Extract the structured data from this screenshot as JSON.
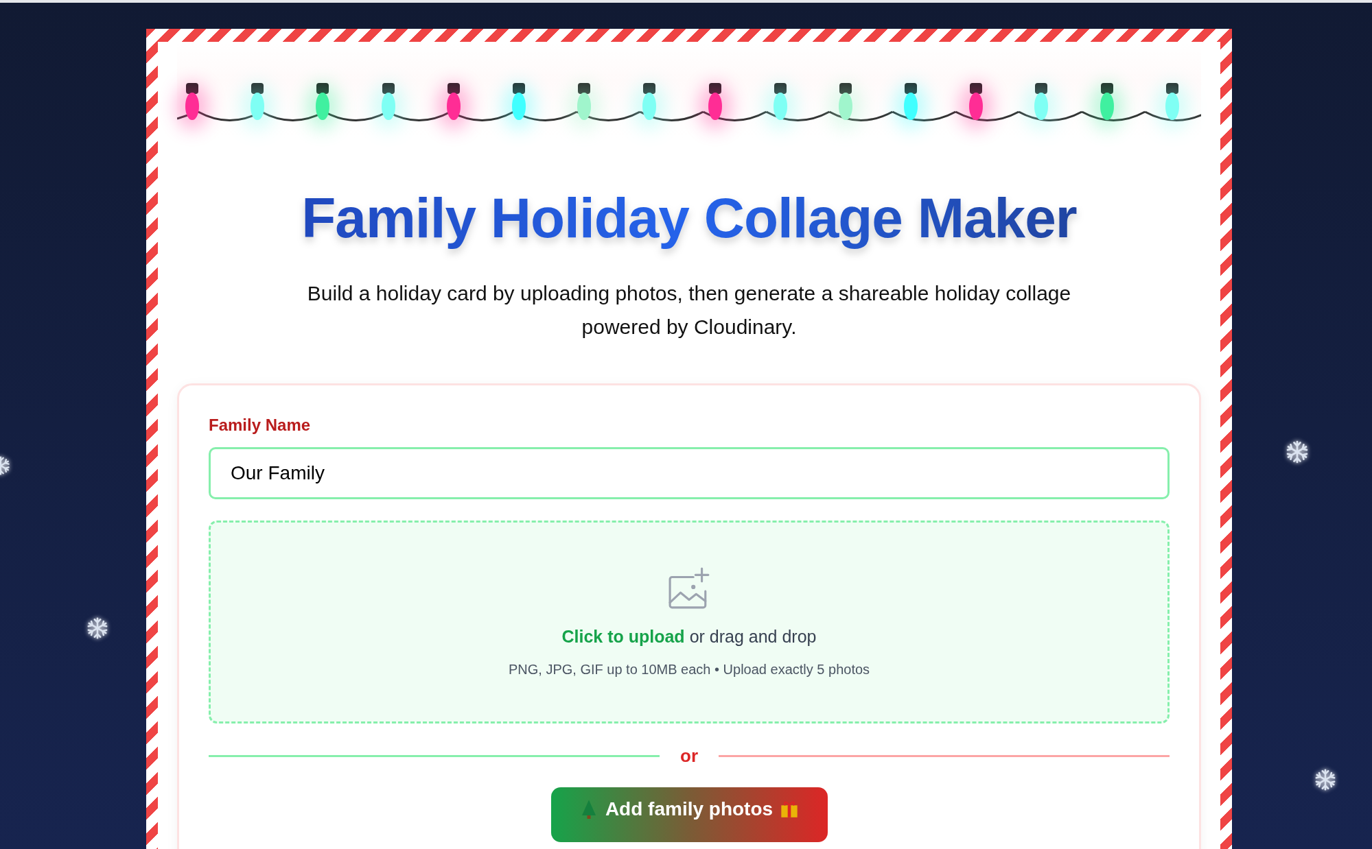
{
  "lights": [
    {
      "color": "#ff2d95"
    },
    {
      "color": "#7ffff4"
    },
    {
      "color": "#40f0a0"
    },
    {
      "color": "#7ffff4"
    },
    {
      "color": "#ff2d95"
    },
    {
      "color": "#40ffff"
    },
    {
      "color": "#a0f5cc"
    },
    {
      "color": "#7ffff4"
    },
    {
      "color": "#ff2d95"
    },
    {
      "color": "#7ffff4"
    },
    {
      "color": "#a0f5cc"
    },
    {
      "color": "#40ffff"
    },
    {
      "color": "#ff2d95"
    },
    {
      "color": "#7ffff4"
    },
    {
      "color": "#40f0a0"
    },
    {
      "color": "#7ffff4"
    }
  ],
  "title": "Family Holiday Collage Maker",
  "subtitle": "Build a holiday card by uploading photos, then generate a shareable holiday collage powered by Cloudinary.",
  "form": {
    "family_name": {
      "label": "Family Name",
      "value": "Our Family"
    },
    "upload": {
      "link": "Click to upload",
      "text": "or drag and drop",
      "hint": "PNG, JPG, GIF up to 10MB each • Upload exactly 5 photos"
    },
    "divider": "or",
    "add_button": "Add family photos"
  }
}
